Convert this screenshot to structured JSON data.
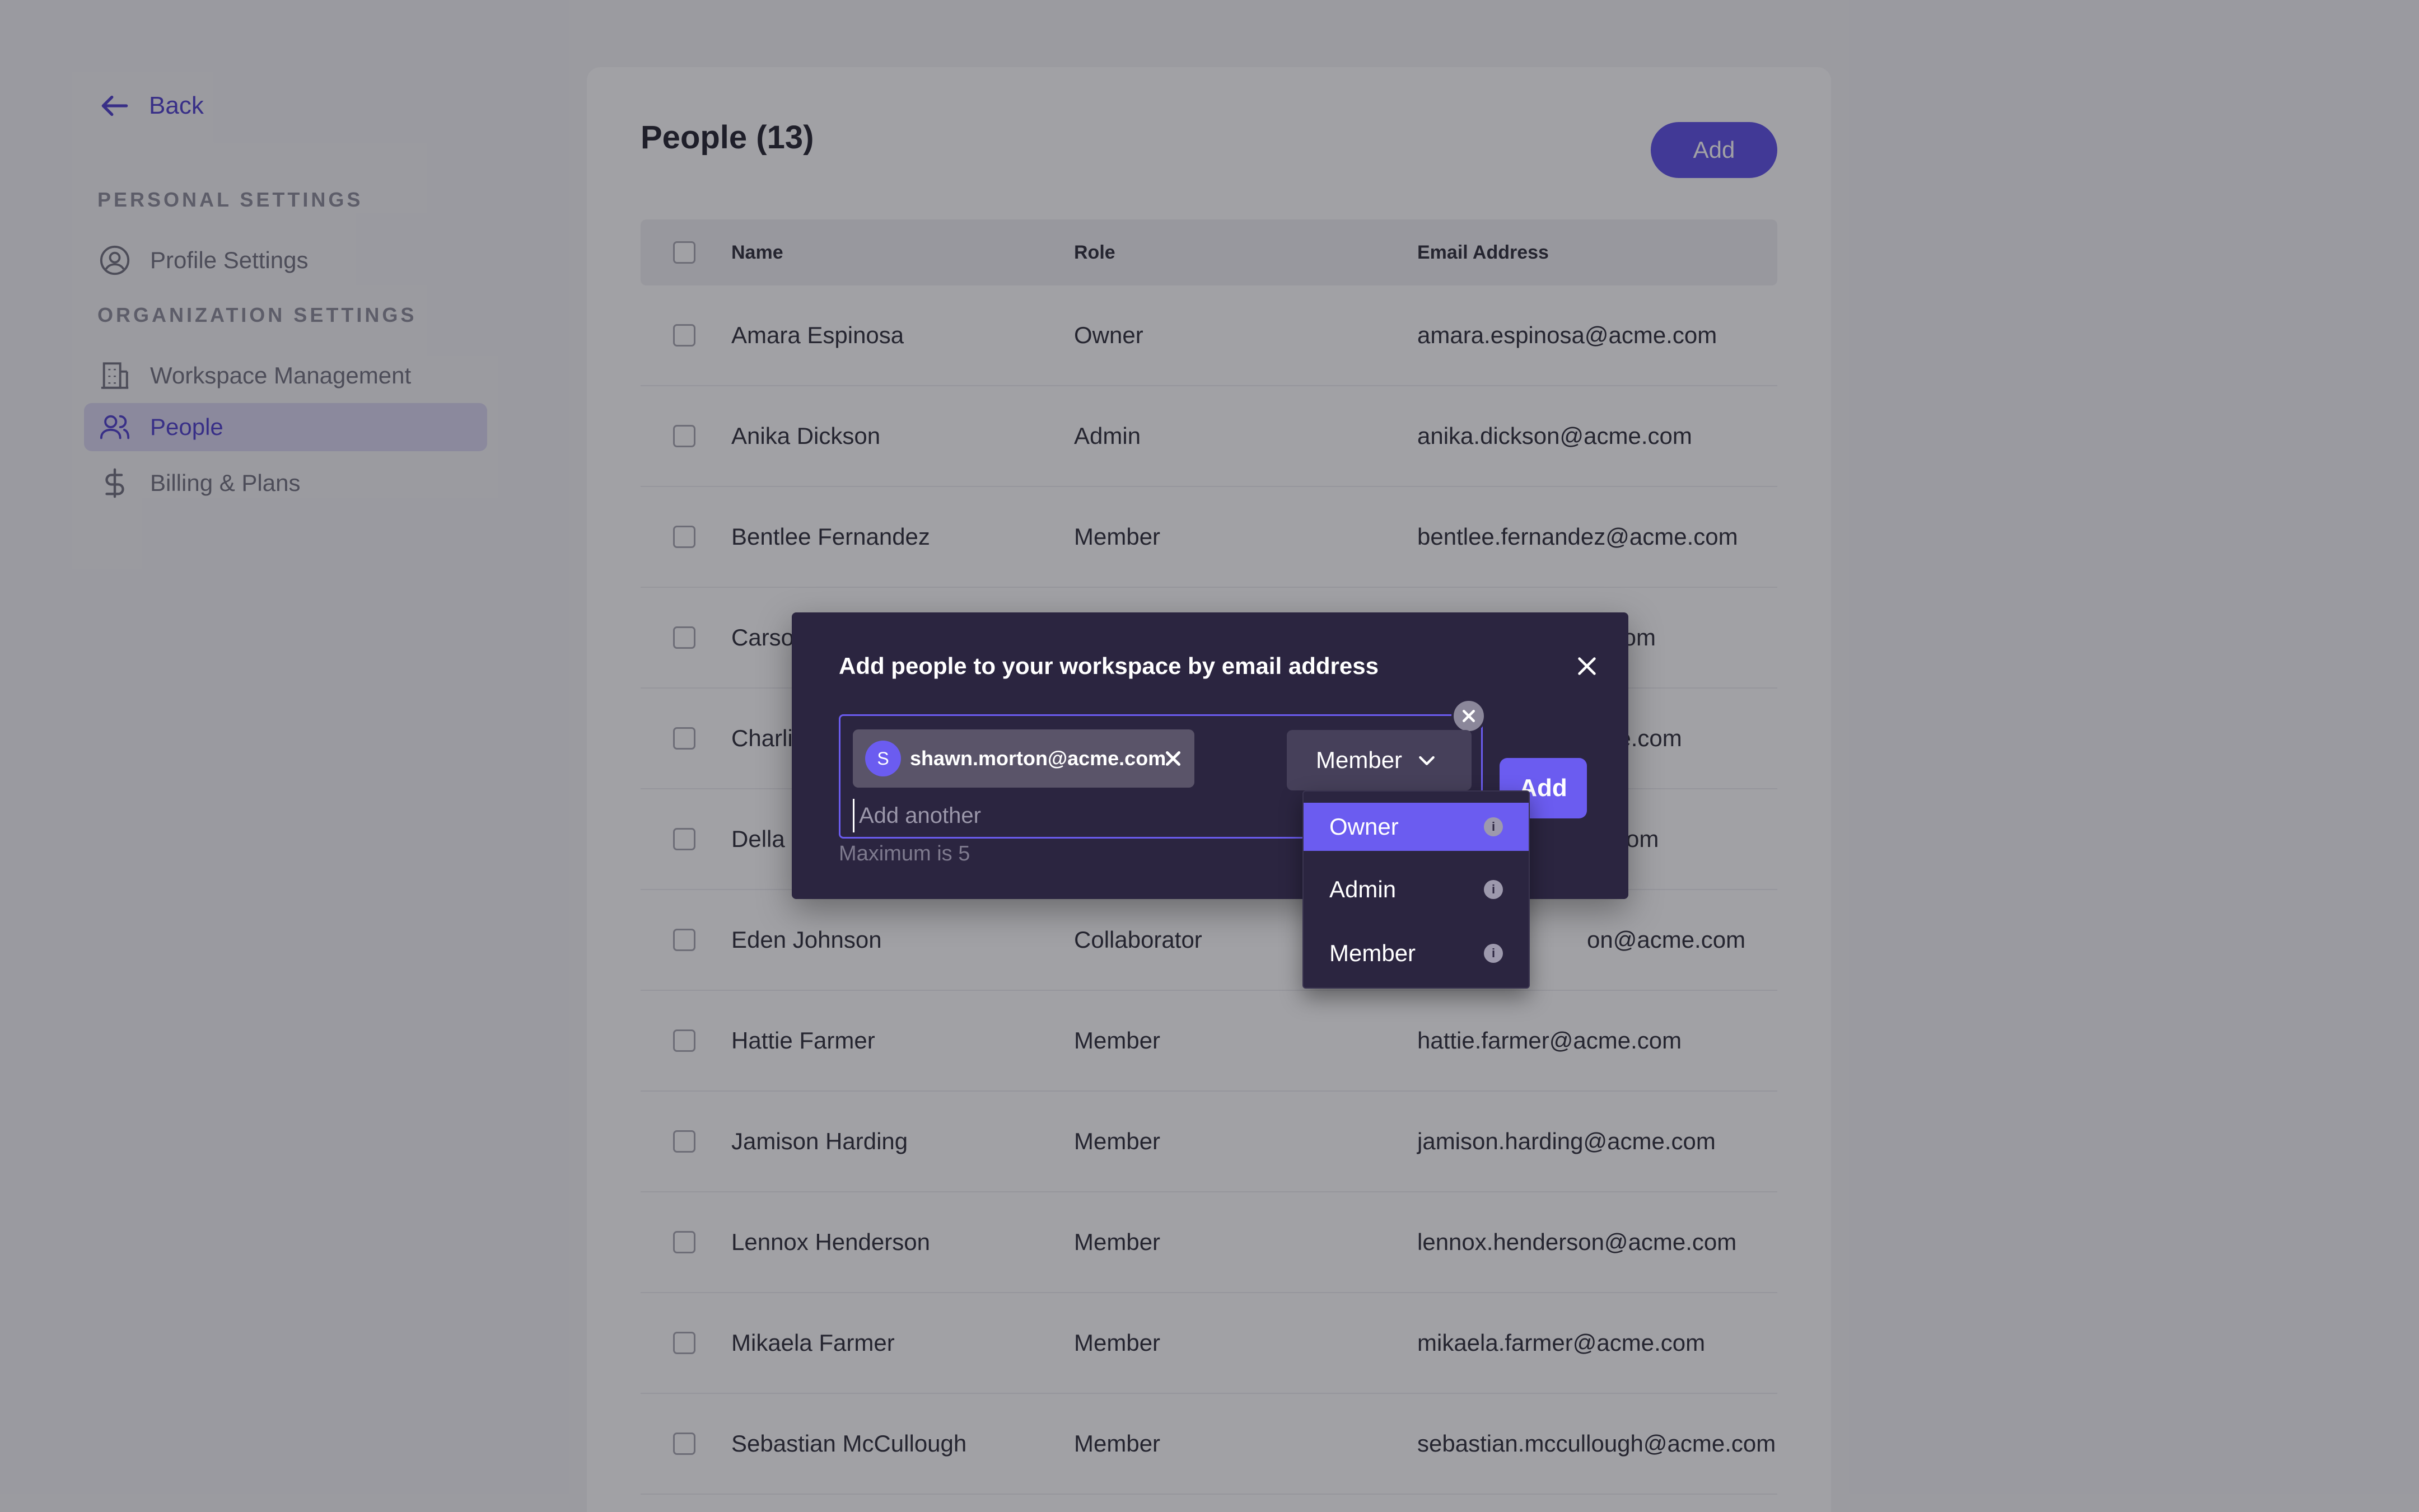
{
  "sidebar": {
    "back_label": "Back",
    "personal_heading": "PERSONAL SETTINGS",
    "organization_heading": "ORGANIZATION SETTINGS",
    "items": [
      {
        "label": "Profile Settings",
        "icon": "user-circle-icon"
      },
      {
        "label": "Workspace Management",
        "icon": "building-icon"
      },
      {
        "label": "People",
        "icon": "users-icon",
        "active": true
      },
      {
        "label": "Billing & Plans",
        "icon": "dollar-icon"
      }
    ]
  },
  "main": {
    "title": "People (13)",
    "add_label": "Add",
    "columns": [
      "Name",
      "Role",
      "Email Address"
    ],
    "rows": [
      {
        "name": "Amara Espinosa",
        "role": "Owner",
        "email": "amara.espinosa@acme.com"
      },
      {
        "name": "Anika Dickson",
        "role": "Admin",
        "email": "anika.dickson@acme.com"
      },
      {
        "name": "Bentlee Fernandez",
        "role": "Member",
        "email": "bentlee.fernandez@acme.com"
      },
      {
        "name": "Carso",
        "role": "",
        "email": ".com"
      },
      {
        "name": "Charli",
        "role": "",
        "email": "ne.com"
      },
      {
        "name": "Della",
        "role": "",
        "email": "om"
      },
      {
        "name": "Eden Johnson",
        "role": "Collaborator",
        "email": "on@acme.com"
      },
      {
        "name": "Hattie Farmer",
        "role": "Member",
        "email": "hattie.farmer@acme.com"
      },
      {
        "name": "Jamison Harding",
        "role": "Member",
        "email": "jamison.harding@acme.com"
      },
      {
        "name": "Lennox Henderson",
        "role": "Member",
        "email": "lennox.henderson@acme.com"
      },
      {
        "name": "Mikaela Farmer",
        "role": "Member",
        "email": "mikaela.farmer@acme.com"
      },
      {
        "name": "Sebastian McCullough",
        "role": "Member",
        "email": "sebastian.mccullough@acme.com"
      }
    ]
  },
  "modal": {
    "title": "Add people to your workspace by email address",
    "chip_initial": "S",
    "chip_email": "shawn.morton@acme.com",
    "input_placeholder": "Add another",
    "role_selected": "Member",
    "add_label": "Add",
    "hint": "Maximum is 5"
  },
  "role_dropdown": {
    "options": [
      {
        "label": "Owner",
        "selected": true
      },
      {
        "label": "Admin",
        "selected": false
      },
      {
        "label": "Member",
        "selected": false
      }
    ],
    "info_glyph": "i"
  },
  "colors": {
    "accent": "#5b4de6",
    "modal_bg": "#2b2540",
    "active_nav_bg": "#d9d6f2"
  }
}
